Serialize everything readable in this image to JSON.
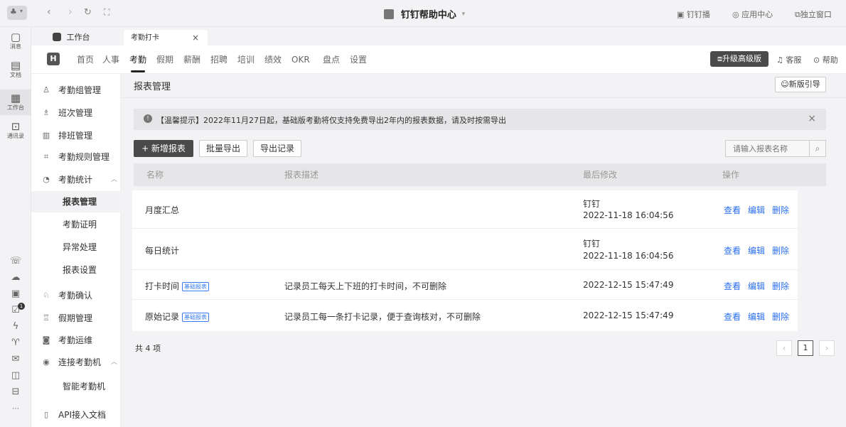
{
  "window": {
    "title": "钉钉帮助中心",
    "live_label": "钉钉播",
    "app_center_label": "应用中心",
    "detach_label": "独立窗口"
  },
  "rail": {
    "items": [
      {
        "label": "消息",
        "icon": "message-icon"
      },
      {
        "label": "文档",
        "icon": "doc-icon"
      },
      {
        "label": "工作台",
        "icon": "grid-icon"
      },
      {
        "label": "通讯录",
        "icon": "contacts-icon"
      }
    ],
    "badge": "1"
  },
  "tabs": [
    {
      "label": "工作台",
      "icon": "workbench-icon"
    },
    {
      "label": "考勤打卡",
      "close": "×"
    }
  ],
  "nav": {
    "logo": "H",
    "items": [
      "首页",
      "人事",
      "考勤",
      "假期",
      "薪酬",
      "招聘",
      "培训",
      "绩效",
      "OKR",
      "盘点",
      "设置"
    ],
    "active": "考勤",
    "upgrade_label": "升级高级版",
    "service_label": "客服",
    "help_label": "帮助"
  },
  "sidebar": {
    "items": [
      {
        "label": "考勤组管理",
        "icon": "user-group-icon"
      },
      {
        "label": "班次管理",
        "icon": "shift-icon"
      },
      {
        "label": "排班管理",
        "icon": "schedule-icon"
      },
      {
        "label": "考勤规则管理",
        "icon": "rules-icon"
      },
      {
        "label": "考勤统计",
        "icon": "stats-icon",
        "expanded": true
      },
      {
        "label": "报表管理",
        "sub": true,
        "active": true
      },
      {
        "label": "考勤证明",
        "sub": true
      },
      {
        "label": "异常处理",
        "sub": true
      },
      {
        "label": "报表设置",
        "sub": true
      },
      {
        "label": "考勤确认",
        "icon": "confirm-icon"
      },
      {
        "label": "假期管理",
        "icon": "leave-icon"
      },
      {
        "label": "考勤运维",
        "icon": "ops-icon"
      },
      {
        "label": "连接考勤机",
        "icon": "device-icon",
        "expanded": true
      },
      {
        "label": "智能考勤机",
        "sub": true
      },
      {
        "label": "API接入文档",
        "icon": "api-icon"
      }
    ]
  },
  "main": {
    "title": "报表管理",
    "guide_label": "新版引导",
    "notice": "【温馨提示】2022年11月27日起，基础版考勤将仅支持免费导出2年内的报表数据，请及时按需导出",
    "buttons": {
      "add": "+ 新增报表",
      "batch_export": "批量导出",
      "export_log": "导出记录"
    },
    "search_placeholder": "请输入报表名称",
    "columns": [
      "名称",
      "报表描述",
      "最后修改",
      "操作"
    ],
    "rows": [
      {
        "name": "月度汇总",
        "tag": "",
        "desc": "",
        "modifier": "钉钉",
        "time": "2022-11-18 16:04:56"
      },
      {
        "name": "每日统计",
        "tag": "",
        "desc": "",
        "modifier": "钉钉",
        "time": "2022-11-18 16:04:56"
      },
      {
        "name": "打卡时间",
        "tag": "基础报表",
        "desc": "记录员工每天上下班的打卡时间，不可删除",
        "modifier": "",
        "time": "2022-12-15 15:47:49"
      },
      {
        "name": "原始记录",
        "tag": "基础报表",
        "desc": "记录员工每一条打卡记录，便于查询核对，不可删除",
        "modifier": "",
        "time": "2022-12-15 15:47:49"
      }
    ],
    "actions": [
      "查看",
      "编辑",
      "删除"
    ],
    "total": "共 4 项",
    "page": "1"
  },
  "colors": {
    "accent": "#2b6ff0",
    "dark_button": "#4a4a4a",
    "sidebar_active": "#f2f2f4"
  }
}
